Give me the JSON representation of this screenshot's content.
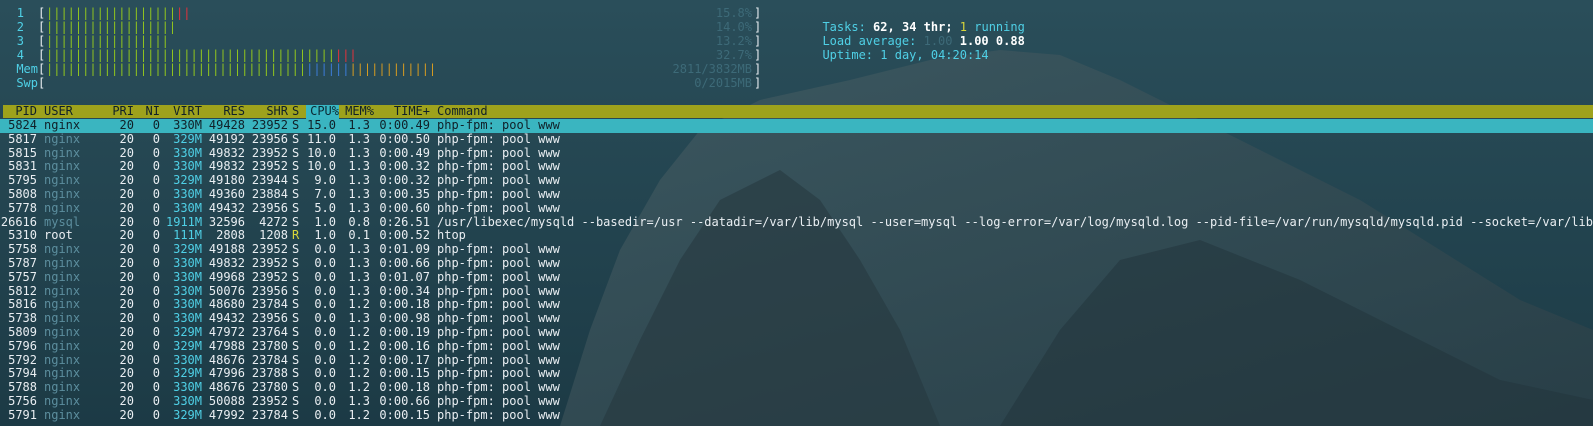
{
  "cpu_meters": [
    {
      "label": "1",
      "value": "15.8%",
      "green": 18,
      "red": 2
    },
    {
      "label": "2",
      "value": "14.0%",
      "green": 18,
      "red": 0
    },
    {
      "label": "3",
      "value": "13.2%",
      "green": 17,
      "red": 0
    },
    {
      "label": "4",
      "value": "32.7%",
      "green": 40,
      "red": 3
    }
  ],
  "mem_meter": {
    "label": "Mem",
    "value": "2811/3832MB",
    "green": 36,
    "blue": 6,
    "yellow": 12
  },
  "swp_meter": {
    "label": "Swp",
    "value": "0/2015MB"
  },
  "summary": {
    "tasks_label": "Tasks:",
    "tasks_value": "62,",
    "threads_value": "34 thr;",
    "running_count": "1",
    "running_label": "running",
    "load_label": "Load average:",
    "load_1": "1.00",
    "load_5": "1.00",
    "load_15": "0.88",
    "uptime_label": "Uptime:",
    "uptime_value": "1 day, 04:20:14"
  },
  "columns": [
    "PID",
    "USER",
    "PRI",
    "NI",
    "VIRT",
    "RES",
    "SHR",
    "S",
    "CPU%",
    "MEM%",
    "TIME+",
    "Command"
  ],
  "sorted_column": "CPU%",
  "processes": [
    {
      "pid": "5824",
      "user": "nginx",
      "pri": "20",
      "ni": "0",
      "virt": "330M",
      "res": "49428",
      "shr": "23952",
      "s": "S",
      "cpu": "15.0",
      "mem": "1.3",
      "time": "0:00.49",
      "cmd": "php-fpm: pool www",
      "selected": true
    },
    {
      "pid": "5817",
      "user": "nginx",
      "pri": "20",
      "ni": "0",
      "virt": "329M",
      "res": "49192",
      "shr": "23956",
      "s": "S",
      "cpu": "11.0",
      "mem": "1.3",
      "time": "0:00.50",
      "cmd": "php-fpm: pool www"
    },
    {
      "pid": "5815",
      "user": "nginx",
      "pri": "20",
      "ni": "0",
      "virt": "330M",
      "res": "49832",
      "shr": "23952",
      "s": "S",
      "cpu": "10.0",
      "mem": "1.3",
      "time": "0:00.49",
      "cmd": "php-fpm: pool www"
    },
    {
      "pid": "5831",
      "user": "nginx",
      "pri": "20",
      "ni": "0",
      "virt": "330M",
      "res": "49832",
      "shr": "23952",
      "s": "S",
      "cpu": "10.0",
      "mem": "1.3",
      "time": "0:00.32",
      "cmd": "php-fpm: pool www"
    },
    {
      "pid": "5795",
      "user": "nginx",
      "pri": "20",
      "ni": "0",
      "virt": "329M",
      "res": "49180",
      "shr": "23944",
      "s": "S",
      "cpu": "9.0",
      "mem": "1.3",
      "time": "0:00.32",
      "cmd": "php-fpm: pool www"
    },
    {
      "pid": "5808",
      "user": "nginx",
      "pri": "20",
      "ni": "0",
      "virt": "330M",
      "res": "49360",
      "shr": "23884",
      "s": "S",
      "cpu": "7.0",
      "mem": "1.3",
      "time": "0:00.35",
      "cmd": "php-fpm: pool www"
    },
    {
      "pid": "5778",
      "user": "nginx",
      "pri": "20",
      "ni": "0",
      "virt": "330M",
      "res": "49432",
      "shr": "23956",
      "s": "S",
      "cpu": "5.0",
      "mem": "1.3",
      "time": "0:00.60",
      "cmd": "php-fpm: pool www"
    },
    {
      "pid": "26616",
      "user": "mysql",
      "pri": "20",
      "ni": "0",
      "virt": "1911M",
      "res": "32596",
      "shr": "4272",
      "s": "S",
      "cpu": "1.0",
      "mem": "0.8",
      "time": "0:26.51",
      "cmd": "/usr/libexec/mysqld --basedir=/usr --datadir=/var/lib/mysql --user=mysql --log-error=/var/log/mysqld.log --pid-file=/var/run/mysqld/mysqld.pid --socket=/var/lib/mys"
    },
    {
      "pid": "5310",
      "user": "root",
      "pri": "20",
      "ni": "0",
      "virt": "111M",
      "res": "2808",
      "shr": "1208",
      "s": "R",
      "cpu": "1.0",
      "mem": "0.1",
      "time": "0:00.52",
      "cmd": "htop"
    },
    {
      "pid": "5758",
      "user": "nginx",
      "pri": "20",
      "ni": "0",
      "virt": "329M",
      "res": "49188",
      "shr": "23952",
      "s": "S",
      "cpu": "0.0",
      "mem": "1.3",
      "time": "0:01.09",
      "cmd": "php-fpm: pool www"
    },
    {
      "pid": "5787",
      "user": "nginx",
      "pri": "20",
      "ni": "0",
      "virt": "330M",
      "res": "49832",
      "shr": "23952",
      "s": "S",
      "cpu": "0.0",
      "mem": "1.3",
      "time": "0:00.66",
      "cmd": "php-fpm: pool www"
    },
    {
      "pid": "5757",
      "user": "nginx",
      "pri": "20",
      "ni": "0",
      "virt": "330M",
      "res": "49968",
      "shr": "23952",
      "s": "S",
      "cpu": "0.0",
      "mem": "1.3",
      "time": "0:01.07",
      "cmd": "php-fpm: pool www"
    },
    {
      "pid": "5812",
      "user": "nginx",
      "pri": "20",
      "ni": "0",
      "virt": "330M",
      "res": "50076",
      "shr": "23956",
      "s": "S",
      "cpu": "0.0",
      "mem": "1.3",
      "time": "0:00.34",
      "cmd": "php-fpm: pool www"
    },
    {
      "pid": "5816",
      "user": "nginx",
      "pri": "20",
      "ni": "0",
      "virt": "330M",
      "res": "48680",
      "shr": "23784",
      "s": "S",
      "cpu": "0.0",
      "mem": "1.2",
      "time": "0:00.18",
      "cmd": "php-fpm: pool www"
    },
    {
      "pid": "5738",
      "user": "nginx",
      "pri": "20",
      "ni": "0",
      "virt": "330M",
      "res": "49432",
      "shr": "23956",
      "s": "S",
      "cpu": "0.0",
      "mem": "1.3",
      "time": "0:00.98",
      "cmd": "php-fpm: pool www"
    },
    {
      "pid": "5809",
      "user": "nginx",
      "pri": "20",
      "ni": "0",
      "virt": "329M",
      "res": "47972",
      "shr": "23764",
      "s": "S",
      "cpu": "0.0",
      "mem": "1.2",
      "time": "0:00.19",
      "cmd": "php-fpm: pool www"
    },
    {
      "pid": "5796",
      "user": "nginx",
      "pri": "20",
      "ni": "0",
      "virt": "329M",
      "res": "47988",
      "shr": "23780",
      "s": "S",
      "cpu": "0.0",
      "mem": "1.2",
      "time": "0:00.16",
      "cmd": "php-fpm: pool www"
    },
    {
      "pid": "5792",
      "user": "nginx",
      "pri": "20",
      "ni": "0",
      "virt": "330M",
      "res": "48676",
      "shr": "23784",
      "s": "S",
      "cpu": "0.0",
      "mem": "1.2",
      "time": "0:00.17",
      "cmd": "php-fpm: pool www"
    },
    {
      "pid": "5794",
      "user": "nginx",
      "pri": "20",
      "ni": "0",
      "virt": "329M",
      "res": "47996",
      "shr": "23788",
      "s": "S",
      "cpu": "0.0",
      "mem": "1.2",
      "time": "0:00.15",
      "cmd": "php-fpm: pool www"
    },
    {
      "pid": "5788",
      "user": "nginx",
      "pri": "20",
      "ni": "0",
      "virt": "330M",
      "res": "48676",
      "shr": "23780",
      "s": "S",
      "cpu": "0.0",
      "mem": "1.2",
      "time": "0:00.18",
      "cmd": "php-fpm: pool www"
    },
    {
      "pid": "5756",
      "user": "nginx",
      "pri": "20",
      "ni": "0",
      "virt": "330M",
      "res": "50088",
      "shr": "23952",
      "s": "S",
      "cpu": "0.0",
      "mem": "1.3",
      "time": "0:00.66",
      "cmd": "php-fpm: pool www"
    },
    {
      "pid": "5791",
      "user": "nginx",
      "pri": "20",
      "ni": "0",
      "virt": "329M",
      "res": "47992",
      "shr": "23784",
      "s": "S",
      "cpu": "0.0",
      "mem": "1.2",
      "time": "0:00.15",
      "cmd": "php-fpm: pool www"
    }
  ],
  "colors": {
    "meter_green": "#8fc31f",
    "meter_red": "#e0323c",
    "meter_blue": "#3c7bd6",
    "meter_yellow": "#d39a22",
    "accent_cyan": "#4fd0e6",
    "header_bar": "#9ea21c",
    "selected_row": "#3ab5c0"
  }
}
